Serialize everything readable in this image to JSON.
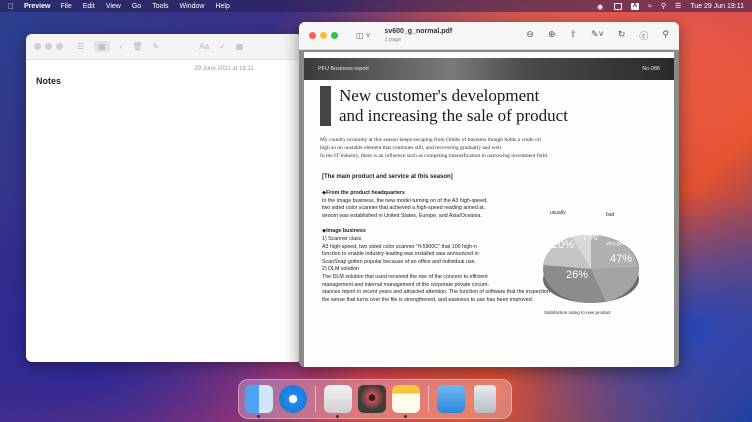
{
  "menubar": {
    "app": "Preview",
    "menus": [
      "File",
      "Edit",
      "View",
      "Go",
      "Tools",
      "Window",
      "Help"
    ],
    "input_source": "A",
    "clock": "Tue 29 Jun  19:11"
  },
  "notes_window": {
    "date": "29 June 2021 at 19:11",
    "title": "Notes",
    "format_label": "Aa"
  },
  "preview_window": {
    "filename": "sv600_g_normal.pdf",
    "pages": "1 page",
    "document": {
      "header_left": "PFU Business report",
      "header_right": "No.086",
      "headline_1": "New customer's development",
      "headline_2": "and increasing the sale of product",
      "intro_1": "My country economy at this season keeps escaping from Odobs of business though holds a crude oil",
      "intro_2": "high so on unstable element that continues still, and recovering gradually and well.",
      "intro_3": "In the IT industry, there is an influence such as competing intensification in narrowing investment field.",
      "section_title": "[The main product and service at this season]",
      "sub1": "◆From the product headquarters",
      "p1_1": "In the image business, the new model turning on of the A3 high-speed,",
      "p1_2": "two sided color scanner that achieved a high-speed reading aimed at.",
      "p1_3": "wroom was established in United States, Europe, and Asia/Oceania.",
      "sub2": "◆Image business",
      "s2_1": "1) Scanner class",
      "p2_1": "A3 high-speed, two sided color scanner \"fi-5900C\" that 100 high-n",
      "p2_2": "function to enable industry-leading was installed was announced in",
      "p2_3": "ScanSnap gotten popular because of an office and individual use.",
      "s2_2": "2) DLM solution",
      "p3_1": "The DLM solution that used received the rise of the concern to efficient",
      "p3_2": "management and internal management of the corporate private circum-",
      "p3_3": "stances report in recent years and attracted attention. The function of software that the inspection of data is possible by",
      "p3_4": "the sense that turns over the file is strengthened, and easiness to use has been improved.",
      "chart_caption": "Satisfaction rating to new product",
      "chart_labels": {
        "usually": "usually",
        "bad": "bad",
        "very_good": "very good"
      },
      "chart_pcts": {
        "usually": "20%",
        "bad": "7%",
        "very_good": "47%",
        "other": "26%"
      }
    }
  },
  "dock": [
    "Finder",
    "Safari",
    "Preview",
    "Photo Booth",
    "Notes",
    "Downloads",
    "Trash"
  ]
}
